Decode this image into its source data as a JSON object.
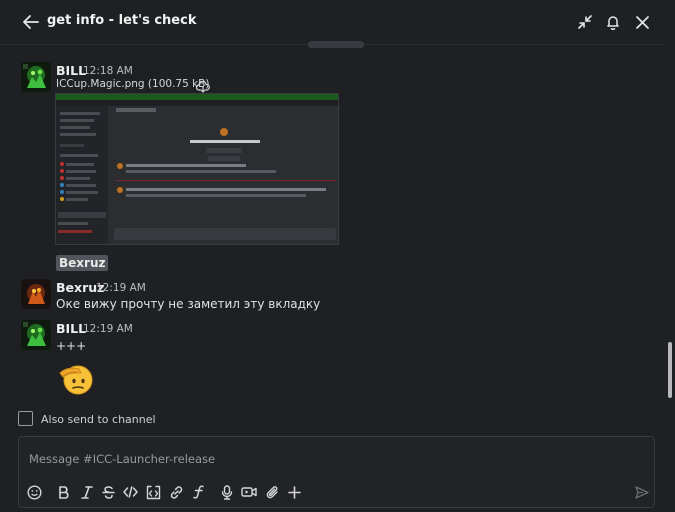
{
  "header": {
    "title": "get info - let's check",
    "icons": [
      "back-arrow-icon",
      "collapse-icon",
      "bell-icon",
      "close-icon"
    ]
  },
  "messages": [
    {
      "author": "BILL",
      "time": "12:18 AM",
      "attachment": {
        "name": "ICCup.Magic.png (100.75 kB)"
      },
      "mention": "Bexruz"
    },
    {
      "author": "Bexruz",
      "time": "12:19 AM",
      "text": "Оке вижу прочту не заметил эту вкладку"
    },
    {
      "author": "BILL",
      "time": "12:19 AM",
      "text": "+++",
      "emoji": "saluting-face"
    }
  ],
  "also_send": {
    "label": "Also send to channel",
    "checked": false
  },
  "composer": {
    "placeholder": "Message #ICC-Launcher-release",
    "tools": [
      "emoji-icon",
      "bold-icon",
      "italic-icon",
      "strikethrough-icon",
      "code-icon",
      "code-block-icon",
      "link-icon",
      "formula-icon",
      "microphone-icon",
      "video-icon",
      "attachment-icon",
      "plus-icon",
      "send-icon"
    ]
  },
  "colors": {
    "background": "#1f2024",
    "accent_green": "#2f8a2f",
    "mention_bg": "#52555b"
  }
}
